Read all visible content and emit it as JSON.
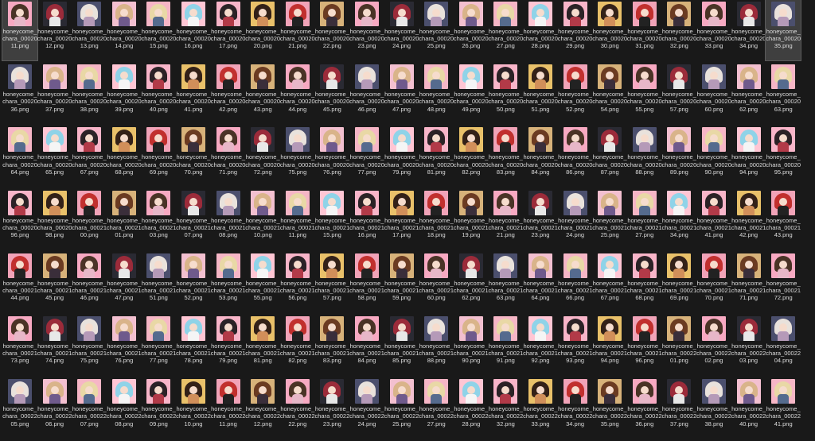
{
  "files": [
    {
      "name": "honeycome_chara_0002011.png",
      "selected": true
    },
    {
      "name": "honeycome_chara_0002012.png"
    },
    {
      "name": "honeycome_chara_0002013.png"
    },
    {
      "name": "honeycome_chara_0002014.png"
    },
    {
      "name": "honeycome_chara_0002015.png"
    },
    {
      "name": "honeycome_chara_0002016.png"
    },
    {
      "name": "honeycome_chara_0002017.png"
    },
    {
      "name": "honeycome_chara_0002020.png"
    },
    {
      "name": "honeycome_chara_0002021.png"
    },
    {
      "name": "honeycome_chara_0002022.png"
    },
    {
      "name": "honeycome_chara_0002023.png"
    },
    {
      "name": "honeycome_chara_0002024.png"
    },
    {
      "name": "honeycome_chara_0002025.png"
    },
    {
      "name": "honeycome_chara_0002026.png"
    },
    {
      "name": "honeycome_chara_0002027.png"
    },
    {
      "name": "honeycome_chara_0002028.png"
    },
    {
      "name": "honeycome_chara_0002029.png"
    },
    {
      "name": "honeycome_chara_0002030.png"
    },
    {
      "name": "honeycome_chara_0002031.png"
    },
    {
      "name": "honeycome_chara_0002032.png"
    },
    {
      "name": "honeycome_chara_0002033.png"
    },
    {
      "name": "honeycome_chara_0002034.png"
    },
    {
      "name": "honeycome_chara_0002035.png",
      "selected": true
    },
    {
      "name": "honeycome_chara_0002036.png"
    },
    {
      "name": "honeycome_chara_0002037.png"
    },
    {
      "name": "honeycome_chara_0002038.png"
    },
    {
      "name": "honeycome_chara_0002039.png"
    },
    {
      "name": "honeycome_chara_0002040.png"
    },
    {
      "name": "honeycome_chara_0002041.png"
    },
    {
      "name": "honeycome_chara_0002042.png"
    },
    {
      "name": "honeycome_chara_0002043.png"
    },
    {
      "name": "honeycome_chara_0002044.png"
    },
    {
      "name": "honeycome_chara_0002045.png"
    },
    {
      "name": "honeycome_chara_0002046.png"
    },
    {
      "name": "honeycome_chara_0002047.png"
    },
    {
      "name": "honeycome_chara_0002048.png"
    },
    {
      "name": "honeycome_chara_0002049.png"
    },
    {
      "name": "honeycome_chara_0002050.png"
    },
    {
      "name": "honeycome_chara_0002051.png"
    },
    {
      "name": "honeycome_chara_0002052.png"
    },
    {
      "name": "honeycome_chara_0002054.png"
    },
    {
      "name": "honeycome_chara_0002055.png"
    },
    {
      "name": "honeycome_chara_0002057.png"
    },
    {
      "name": "honeycome_chara_0002060.png"
    },
    {
      "name": "honeycome_chara_0002062.png"
    },
    {
      "name": "honeycome_chara_0002063.png"
    },
    {
      "name": "honeycome_chara_0002064.png"
    },
    {
      "name": "honeycome_chara_0002065.png"
    },
    {
      "name": "honeycome_chara_0002067.png"
    },
    {
      "name": "honeycome_chara_0002068.png"
    },
    {
      "name": "honeycome_chara_0002069.png"
    },
    {
      "name": "honeycome_chara_0002070.png"
    },
    {
      "name": "honeycome_chara_0002071.png"
    },
    {
      "name": "honeycome_chara_0002072.png"
    },
    {
      "name": "honeycome_chara_0002075.png"
    },
    {
      "name": "honeycome_chara_0002076.png"
    },
    {
      "name": "honeycome_chara_0002077.png"
    },
    {
      "name": "honeycome_chara_0002079.png"
    },
    {
      "name": "honeycome_chara_0002081.png"
    },
    {
      "name": "honeycome_chara_0002082.png"
    },
    {
      "name": "honeycome_chara_0002083.png"
    },
    {
      "name": "honeycome_chara_0002084.png"
    },
    {
      "name": "honeycome_chara_0002086.png"
    },
    {
      "name": "honeycome_chara_0002087.png"
    },
    {
      "name": "honeycome_chara_0002088.png"
    },
    {
      "name": "honeycome_chara_0002089.png"
    },
    {
      "name": "honeycome_chara_0002090.png"
    },
    {
      "name": "honeycome_chara_0002094.png"
    },
    {
      "name": "honeycome_chara_0002095.png"
    },
    {
      "name": "honeycome_chara_0002096.png"
    },
    {
      "name": "honeycome_chara_0002098.png"
    },
    {
      "name": "honeycome_chara_0002100.png"
    },
    {
      "name": "honeycome_chara_0002101.png"
    },
    {
      "name": "honeycome_chara_0002103.png"
    },
    {
      "name": "honeycome_chara_0002107.png"
    },
    {
      "name": "honeycome_chara_0002108.png"
    },
    {
      "name": "honeycome_chara_0002110.png"
    },
    {
      "name": "honeycome_chara_0002111.png"
    },
    {
      "name": "honeycome_chara_0002115.png"
    },
    {
      "name": "honeycome_chara_0002116.png"
    },
    {
      "name": "honeycome_chara_0002117.png"
    },
    {
      "name": "honeycome_chara_0002118.png"
    },
    {
      "name": "honeycome_chara_0002119.png"
    },
    {
      "name": "honeycome_chara_0002121.png"
    },
    {
      "name": "honeycome_chara_0002123.png"
    },
    {
      "name": "honeycome_chara_0002124.png"
    },
    {
      "name": "honeycome_chara_0002125.png"
    },
    {
      "name": "honeycome_chara_0002127.png"
    },
    {
      "name": "honeycome_chara_0002134.png"
    },
    {
      "name": "honeycome_chara_0002141.png"
    },
    {
      "name": "honeycome_chara_0002142.png"
    },
    {
      "name": "honeycome_chara_0002143.png"
    },
    {
      "name": "honeycome_chara_0002144.png"
    },
    {
      "name": "honeycome_chara_0002145.png"
    },
    {
      "name": "honeycome_chara_0002146.png"
    },
    {
      "name": "honeycome_chara_0002147.png"
    },
    {
      "name": "honeycome_chara_0002151.png"
    },
    {
      "name": "honeycome_chara_0002152.png"
    },
    {
      "name": "honeycome_chara_0002153.png"
    },
    {
      "name": "honeycome_chara_0002155.png"
    },
    {
      "name": "honeycome_chara_0002156.png"
    },
    {
      "name": "honeycome_chara_0002157.png"
    },
    {
      "name": "honeycome_chara_0002158.png"
    },
    {
      "name": "honeycome_chara_0002159.png"
    },
    {
      "name": "honeycome_chara_0002160.png"
    },
    {
      "name": "honeycome_chara_0002162.png"
    },
    {
      "name": "honeycome_chara_0002163.png"
    },
    {
      "name": "honeycome_chara_0002164.png"
    },
    {
      "name": "honeycome_chara_0002166.png"
    },
    {
      "name": "honeycome_chara_0002167.png"
    },
    {
      "name": "honeycome_chara_0002168.png"
    },
    {
      "name": "honeycome_chara_0002169.png"
    },
    {
      "name": "honeycome_chara_0002170.png"
    },
    {
      "name": "honeycome_chara_0002171.png"
    },
    {
      "name": "honeycome_chara_0002172.png"
    },
    {
      "name": "honeycome_chara_0002173.png"
    },
    {
      "name": "honeycome_chara_0002174.png"
    },
    {
      "name": "honeycome_chara_0002175.png"
    },
    {
      "name": "honeycome_chara_0002176.png"
    },
    {
      "name": "honeycome_chara_0002177.png"
    },
    {
      "name": "honeycome_chara_0002178.png"
    },
    {
      "name": "honeycome_chara_0002179.png"
    },
    {
      "name": "honeycome_chara_0002181.png"
    },
    {
      "name": "honeycome_chara_0002182.png"
    },
    {
      "name": "honeycome_chara_0002183.png"
    },
    {
      "name": "honeycome_chara_0002184.png"
    },
    {
      "name": "honeycome_chara_0002185.png"
    },
    {
      "name": "honeycome_chara_0002188.png"
    },
    {
      "name": "honeycome_chara_0002190.png"
    },
    {
      "name": "honeycome_chara_0002191.png"
    },
    {
      "name": "honeycome_chara_0002192.png"
    },
    {
      "name": "honeycome_chara_0002193.png"
    },
    {
      "name": "honeycome_chara_0002194.png"
    },
    {
      "name": "honeycome_chara_0002196.png"
    },
    {
      "name": "honeycome_chara_0002201.png"
    },
    {
      "name": "honeycome_chara_0002202.png"
    },
    {
      "name": "honeycome_chara_0002203.png"
    },
    {
      "name": "honeycome_chara_0002204.png"
    },
    {
      "name": "honeycome_chara_0002205.png"
    },
    {
      "name": "honeycome_chara_0002206.png"
    },
    {
      "name": "honeycome_chara_0002207.png"
    },
    {
      "name": "honeycome_chara_0002208.png"
    },
    {
      "name": "honeycome_chara_0002209.png"
    },
    {
      "name": "honeycome_chara_0002210.png"
    },
    {
      "name": "honeycome_chara_0002211.png"
    },
    {
      "name": "honeycome_chara_0002212.png"
    },
    {
      "name": "honeycome_chara_0002222.png"
    },
    {
      "name": "honeycome_chara_0002223.png"
    },
    {
      "name": "honeycome_chara_0002224.png"
    },
    {
      "name": "honeycome_chara_0002225.png"
    },
    {
      "name": "honeycome_chara_0002227.png"
    },
    {
      "name": "honeycome_chara_0002228.png"
    },
    {
      "name": "honeycome_chara_0002232.png"
    },
    {
      "name": "honeycome_chara_0002233.png"
    },
    {
      "name": "honeycome_chara_0002234.png"
    },
    {
      "name": "honeycome_chara_0002235.png"
    },
    {
      "name": "honeycome_chara_0002236.png"
    },
    {
      "name": "honeycome_chara_0002237.png"
    },
    {
      "name": "honeycome_chara_0002238.png"
    },
    {
      "name": "honeycome_chara_0002240.png"
    },
    {
      "name": "honeycome_chara_0002241.png"
    }
  ]
}
